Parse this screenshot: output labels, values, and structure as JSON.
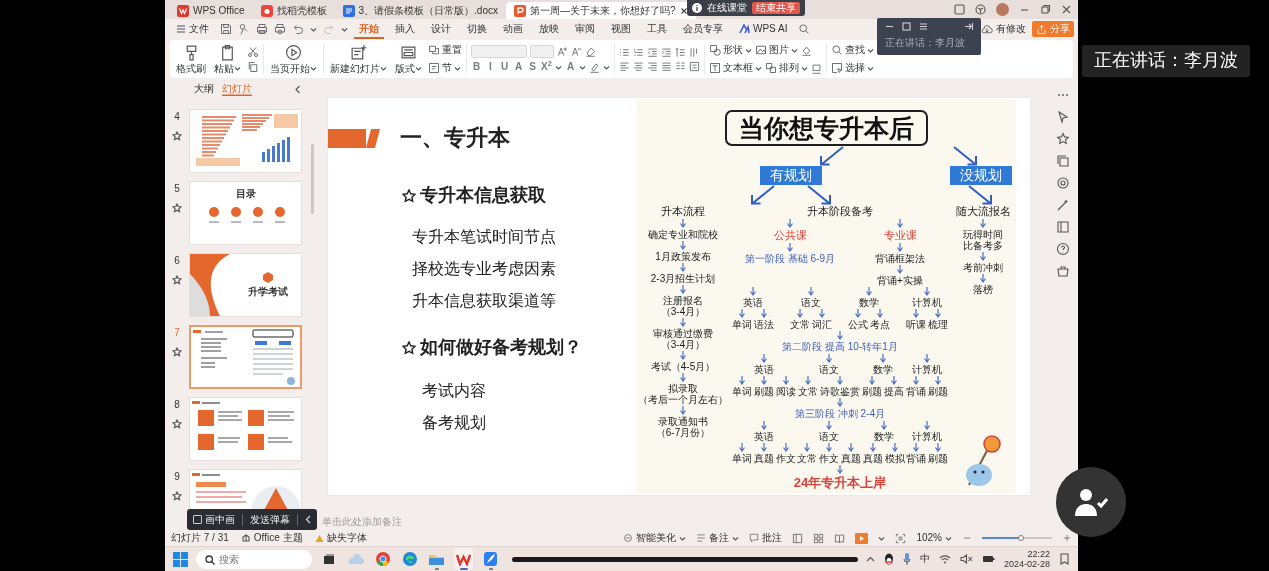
{
  "tabs": [
    {
      "label": "WPS Office",
      "kind": "home",
      "selected": false
    },
    {
      "label": "找稻壳模板",
      "kind": "template",
      "selected": false
    },
    {
      "label": "3、请假条模板（日常版）.docx",
      "kind": "writer",
      "selected": false
    },
    {
      "label": "第一周—关于未来，你想好了吗?",
      "kind": "slides",
      "selected": true
    }
  ],
  "share_bar": {
    "label": "在线课堂",
    "stop_button": "结束共享"
  },
  "menu": {
    "file": "文件",
    "tabs": [
      {
        "label": "开始",
        "selected": true
      },
      {
        "label": "插入",
        "selected": false
      },
      {
        "label": "设计",
        "selected": false
      },
      {
        "label": "切换",
        "selected": false
      },
      {
        "label": "动画",
        "selected": false
      },
      {
        "label": "放映",
        "selected": false
      },
      {
        "label": "审阅",
        "selected": false
      },
      {
        "label": "视图",
        "selected": false
      },
      {
        "label": "工具",
        "selected": false
      },
      {
        "label": "会员专享",
        "selected": false
      },
      {
        "label": "WPS AI",
        "selected": false
      }
    ],
    "modified": "有修改",
    "share": "分享"
  },
  "ribbon": {
    "clipboard": {
      "format_painter": "格式刷",
      "paste": "粘贴"
    },
    "play_from_current": "当页开始",
    "slides": {
      "new_slide": "新建幻灯片",
      "layout": "版式",
      "reset": "重置",
      "section": "节"
    },
    "font": {
      "disabled": true,
      "buttons": [
        "B",
        "I",
        "U",
        "A",
        "S",
        "X$^{2}$",
        "A"
      ]
    },
    "drawing": {
      "shape": "形状",
      "picture": "图片",
      "textbox": "文本框",
      "arrange": "排列"
    },
    "editing": {
      "find": "查找",
      "select": "选择"
    }
  },
  "presenter_panel": {
    "speaking": "正在讲话：李月波"
  },
  "panel_tabs": [
    {
      "label": "大纲",
      "selected": false
    },
    {
      "label": "幻灯片",
      "selected": true
    }
  ],
  "slides": [
    {
      "number": "4",
      "kind": "chart",
      "selected": false
    },
    {
      "number": "5",
      "kind": "contents",
      "title": "目录",
      "selected": false
    },
    {
      "number": "6",
      "kind": "section",
      "title": "升学考试",
      "selected": false
    },
    {
      "number": "7",
      "kind": "flow",
      "selected": true
    },
    {
      "number": "8",
      "kind": "grid",
      "selected": false
    },
    {
      "number": "9",
      "kind": "pyramid",
      "selected": false
    }
  ],
  "live_toolbar": {
    "pip": {
      "label": "画中画",
      "checked": false
    },
    "danmaku": "发送弹幕"
  },
  "slide": {
    "heading": "一、专升本",
    "sections": [
      {
        "title": "专升本信息获取",
        "items": [
          "专升本笔试时间节点",
          "择校选专业考虑因素",
          "升本信息获取渠道等"
        ]
      },
      {
        "title": "如何做好备考规划？",
        "items": [
          "考试内容",
          "备考规划"
        ]
      }
    ],
    "flowchart": {
      "title": "当你想专升本后",
      "branches": [
        "有规划",
        "没规划"
      ],
      "process": {
        "title": "升本流程",
        "steps": [
          {
            "text": "确定专业和院校"
          },
          {
            "text": "1月政策发布"
          },
          {
            "text": "2-3月招生计划"
          },
          {
            "text": "注册报名",
            "note": "（3-4月）"
          },
          {
            "text": "审核通过缴费",
            "note": "（3-4月）"
          },
          {
            "text": "考试（4-5月）"
          },
          {
            "text": "拟录取",
            "note": "（考后一个月左右）"
          },
          {
            "text": "录取通知书",
            "note": "（6-7月份）"
          }
        ]
      },
      "prep": {
        "title": "升本阶段备考",
        "public": "公共课",
        "major": "专业课",
        "major_steps": [
          "背诵框架法",
          "背诵+实操"
        ],
        "stages": [
          {
            "title": "第一阶段 基础 6-9月",
            "subjects": [
              {
                "name": "英语",
                "items": [
                  "单词",
                  "语法"
                ]
              },
              {
                "name": "语文",
                "items": [
                  "文常",
                  "词汇"
                ]
              },
              {
                "name": "数学",
                "items": [
                  "公式",
                  "考点"
                ]
              },
              {
                "name": "计算机",
                "items": [
                  "听课",
                  "梳理"
                ]
              }
            ]
          },
          {
            "title": "第二阶段 提高 10-转年1月",
            "subjects": [
              {
                "name": "英语",
                "items": [
                  "单词",
                  "刷题",
                  "阅读"
                ]
              },
              {
                "name": "语文",
                "items": [
                  "文常",
                  "诗歌鉴赏"
                ]
              },
              {
                "name": "数学",
                "items": [
                  "刷题",
                  "提高"
                ]
              },
              {
                "name": "计算机",
                "items": [
                  "背诵",
                  "刷题"
                ]
              }
            ]
          },
          {
            "title": "第三阶段 冲刺 2-4月",
            "subjects": [
              {
                "name": "英语",
                "items": [
                  "单词",
                  "真题",
                  "作文"
                ]
              },
              {
                "name": "语文",
                "items": [
                  "文常",
                  "作文",
                  "真题"
                ]
              },
              {
                "name": "数学",
                "items": [
                  "真题",
                  "模拟"
                ]
              },
              {
                "name": "计算机",
                "items": [
                  "背诵",
                  "刷题"
                ]
              }
            ]
          }
        ],
        "goal": "24年专升本上岸"
      },
      "no_plan": {
        "title": "随大流报名",
        "steps": [
          {
            "text": "玩得时间",
            "note": "比备考多"
          },
          {
            "text": "考前冲刺"
          },
          {
            "text": "落榜"
          }
        ]
      }
    }
  },
  "notes_placeholder": "单击此处添加备注",
  "status_bar": {
    "position": "幻灯片 7 / 31",
    "theme": "Office 主题",
    "missing_fonts": "缺失字体",
    "beautify": "智能美化",
    "notes": "备注",
    "comments": "批注",
    "zoom": "102%",
    "zoom_slider": {
      "level": 0.55
    }
  },
  "taskbar": {
    "search_placeholder": "搜索",
    "apps": [
      {
        "kind": "task-view",
        "running": false,
        "selected": false
      },
      {
        "kind": "weather",
        "running": false,
        "selected": false
      },
      {
        "kind": "chrome",
        "running": false,
        "selected": false
      },
      {
        "kind": "edge",
        "running": false,
        "selected": false
      },
      {
        "kind": "folder",
        "running": true,
        "selected": false
      },
      {
        "kind": "wps",
        "running": true,
        "selected": true
      },
      {
        "kind": "feather",
        "running": true,
        "selected": false
      }
    ],
    "ime": "中",
    "time": "22:22",
    "date": "2024-02-28"
  },
  "speaker_label": "正在讲话：李月波"
}
